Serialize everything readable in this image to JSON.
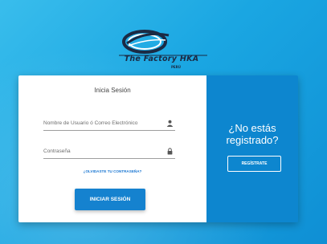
{
  "brand": {
    "name": "The Factory HKA",
    "sub": "PERÚ"
  },
  "login": {
    "title": "Inicia Sesión",
    "username_placeholder": "Nombre de Usuario ó Correo Electrónico",
    "username_value": "",
    "password_placeholder": "Contraseña",
    "password_value": "",
    "username_icon": "person-icon",
    "password_icon": "lock-icon",
    "forgot_link": "¿OLVIDASTE TU CONTRASEÑA?",
    "submit_label": "INICIAR SESIÓN"
  },
  "register": {
    "title": "¿No estás registrado?",
    "button_label": "REGÍSTRATE"
  },
  "colors": {
    "background": "#1aa6e2",
    "primary": "#1582cf",
    "register_panel": "#0d86cf",
    "link": "#1976d2"
  }
}
